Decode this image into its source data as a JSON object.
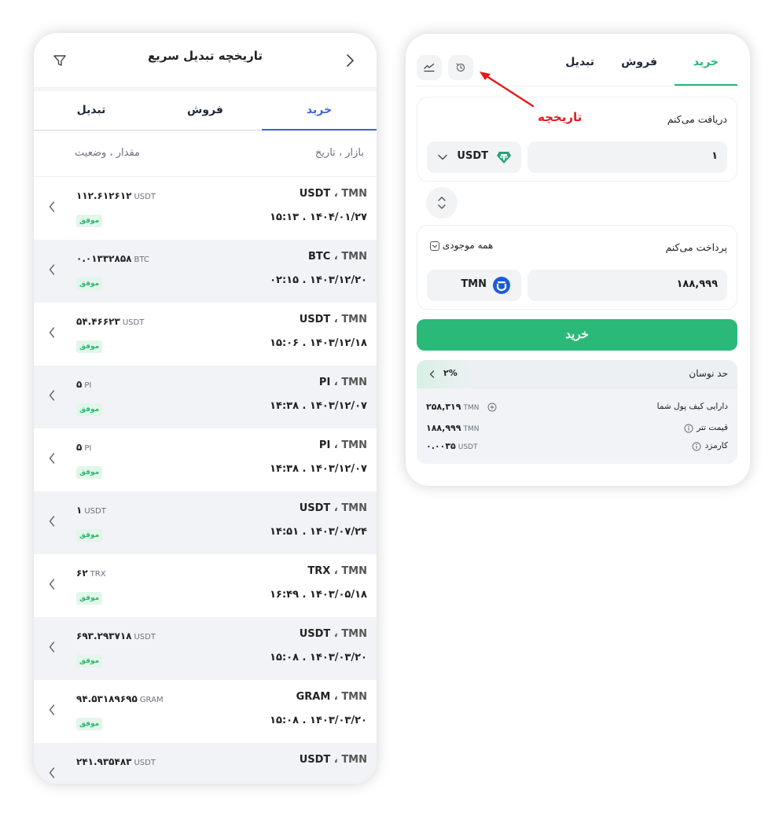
{
  "history": {
    "title": "تاریخچه تبدیل سریع",
    "tabs": [
      "خرید",
      "فروش",
      "تبدیل"
    ],
    "columns": {
      "market_date": "بازار ، تاریخ",
      "amount_status": "مقدار ، وضعیت"
    },
    "rows": [
      {
        "quote": "TMN",
        "sep": "،",
        "base": "USDT",
        "date": "۱۴۰۴/۰۱/۲۷ . ۱۵:۱۳",
        "amount": "۱۱۲.۶۱۲۶۱۲",
        "currency": "USDT",
        "status": "موفق"
      },
      {
        "quote": "TMN",
        "sep": "،",
        "base": "BTC",
        "date": "۱۴۰۳/۱۲/۲۰ . ۰۲:۱۵",
        "amount": "۰.۰۱۳۳۲۸۵۸",
        "currency": "BTC",
        "status": "موفق"
      },
      {
        "quote": "TMN",
        "sep": "،",
        "base": "USDT",
        "date": "۱۴۰۳/۱۲/۱۸ . ۱۵:۰۶",
        "amount": "۵۴.۴۶۶۲۳",
        "currency": "USDT",
        "status": "موفق"
      },
      {
        "quote": "TMN",
        "sep": "،",
        "base": "PI",
        "date": "۱۴۰۳/۱۲/۰۷ . ۱۴:۳۸",
        "amount": "۵",
        "currency": "PI",
        "status": "موفق"
      },
      {
        "quote": "TMN",
        "sep": "،",
        "base": "PI",
        "date": "۱۴۰۳/۱۲/۰۷ . ۱۴:۳۸",
        "amount": "۵",
        "currency": "PI",
        "status": "موفق"
      },
      {
        "quote": "TMN",
        "sep": "،",
        "base": "USDT",
        "date": "۱۴۰۳/۰۷/۲۴ . ۱۴:۵۱",
        "amount": "۱",
        "currency": "USDT",
        "status": "موفق"
      },
      {
        "quote": "TMN",
        "sep": "،",
        "base": "TRX",
        "date": "۱۴۰۳/۰۵/۱۸ . ۱۶:۴۹",
        "amount": "۶۲",
        "currency": "TRX",
        "status": "موفق"
      },
      {
        "quote": "TMN",
        "sep": "،",
        "base": "USDT",
        "date": "۱۴۰۳/۰۳/۲۰ . ۱۵:۰۸",
        "amount": "۶۹۳.۲۹۳۷۱۸",
        "currency": "USDT",
        "status": "موفق"
      },
      {
        "quote": "TMN",
        "sep": "،",
        "base": "GRAM",
        "date": "۱۴۰۳/۰۳/۲۰ . ۱۵:۰۸",
        "amount": "۹۴.۵۳۱۸۹۶۹۵",
        "currency": "GRAM",
        "status": "موفق"
      },
      {
        "quote": "TMN",
        "sep": "،",
        "base": "USDT",
        "date": "",
        "amount": "۲۴۱.۹۳۵۴۸۳",
        "currency": "USDT",
        "status": ""
      }
    ]
  },
  "trade": {
    "tabs": {
      "buy": "خرید",
      "sell": "فروش",
      "exchange": "تبدیل"
    },
    "receive": {
      "label": "دریافت می‌کنم",
      "value": "۱",
      "currency": "USDT"
    },
    "pay": {
      "label": "پرداخت می‌کنم",
      "all_balance": "همه موجودی",
      "value": "۱۸۸,۹۹۹",
      "currency": "TMN"
    },
    "buy_button": "خرید",
    "slippage": {
      "label": "حد نوسان",
      "value": "۲%"
    },
    "info": [
      {
        "label": "دارایی کیف پول شما",
        "value": "۲۵۸,۳۱۹",
        "currency": "TMN"
      },
      {
        "label": "قیمت تتر",
        "value": "۱۸۸,۹۹۹",
        "currency": "TMN"
      },
      {
        "label": "کارمزد",
        "value": "۰.۰۰۳۵",
        "currency": "USDT"
      }
    ]
  },
  "annotation": {
    "label": "تاریخچه"
  },
  "colors": {
    "accent_green": "#2bb97a",
    "accent_blue": "#3b67d6",
    "annotation_red": "#e31b1b",
    "tether": "#26a17b",
    "toman_blue": "#1e5bd8"
  }
}
